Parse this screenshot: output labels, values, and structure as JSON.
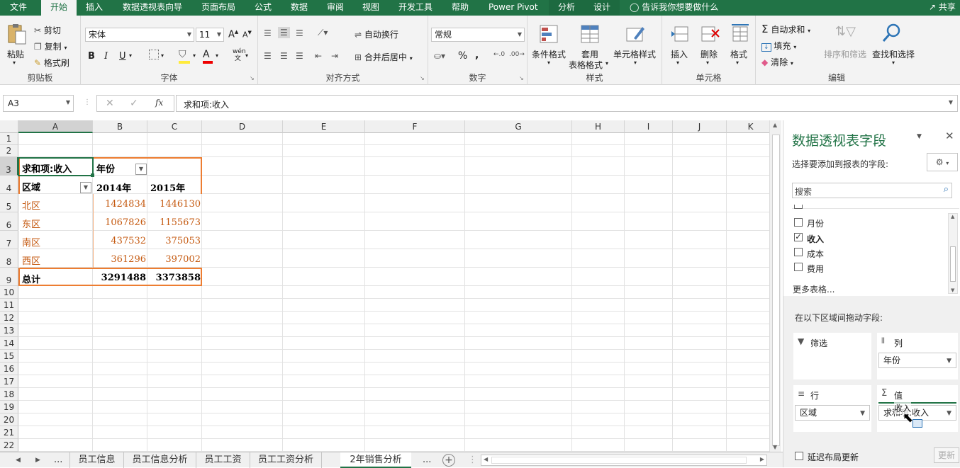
{
  "menu": {
    "tabs": [
      "文件",
      "开始",
      "插入",
      "数据透视表向导",
      "页面布局",
      "公式",
      "数据",
      "审阅",
      "视图",
      "开发工具",
      "帮助",
      "Power Pivot",
      "分析",
      "设计"
    ],
    "tellme": "告诉我你想要做什么",
    "share": "共享"
  },
  "ribbon": {
    "clipboard": {
      "paste": "粘贴",
      "cut": "剪切",
      "copy": "复制",
      "format_painter": "格式刷",
      "label": "剪贴板"
    },
    "font": {
      "name": "宋体",
      "size": "11",
      "label": "字体",
      "bold": "B",
      "italic": "I",
      "underline": "U",
      "phonetic": "wén"
    },
    "align": {
      "wrap": "自动换行",
      "merge": "合并后居中",
      "label": "对齐方式"
    },
    "number": {
      "format": "常规",
      "label": "数字",
      "percent": "%",
      "comma": ","
    },
    "styles": {
      "cond": "条件格式",
      "table1": "套用",
      "table2": "表格格式",
      "cell": "单元格样式",
      "label": "样式"
    },
    "cells": {
      "insert": "插入",
      "delete": "删除",
      "format": "格式",
      "label": "单元格"
    },
    "edit": {
      "autosum": "自动求和",
      "fill": "填充",
      "clear": "清除",
      "sort": "排序和筛选",
      "find": "查找和选择",
      "label": "编辑"
    }
  },
  "formula": {
    "namebox": "A3",
    "fx": "fx",
    "content": "求和项:收入"
  },
  "grid": {
    "columns": [
      "A",
      "B",
      "C",
      "D",
      "E",
      "F",
      "G",
      "H",
      "I",
      "J",
      "K"
    ],
    "rows": [
      "1",
      "2",
      "3",
      "4",
      "5",
      "6",
      "7",
      "8",
      "9",
      "10",
      "11",
      "12",
      "13",
      "14",
      "15",
      "16",
      "17",
      "18",
      "19",
      "20",
      "21",
      "22"
    ],
    "pivot": {
      "value_label": "求和项:收入",
      "col_field": "年份",
      "row_field": "区域",
      "years": [
        "2014年",
        "2015年"
      ],
      "regions": [
        "北区",
        "东区",
        "南区",
        "西区"
      ],
      "values": [
        [
          "1424834",
          "1446130"
        ],
        [
          "1067826",
          "1155673"
        ],
        [
          "437532",
          "375053"
        ],
        [
          "361296",
          "397002"
        ]
      ],
      "total_label": "总计",
      "totals": [
        "3291488",
        "3373858"
      ]
    }
  },
  "sheets": {
    "tabs": [
      "员工信息",
      "员工信息分析",
      "员工工资",
      "员工工资分析",
      "2年销售分析"
    ],
    "ellipsis": "...",
    "ellipsis2": "..."
  },
  "pane": {
    "title": "数据透视表字段",
    "subtitle": "选择要添加到报表的字段:",
    "search_placeholder": "搜索",
    "fields": [
      {
        "name": "月份",
        "checked": false
      },
      {
        "name": "收入",
        "checked": true
      },
      {
        "name": "成本",
        "checked": false
      },
      {
        "name": "费用",
        "checked": false
      }
    ],
    "more": "更多表格...",
    "drag_hint": "在以下区域间拖动字段:",
    "filter_label": "筛选",
    "col_label": "列",
    "row_label": "行",
    "value_label": "值",
    "col_item": "年份",
    "row_item": "区域",
    "value_item": "求和项:收入",
    "drag_item": "收入",
    "defer": "延迟布局更新",
    "update": "更新"
  }
}
